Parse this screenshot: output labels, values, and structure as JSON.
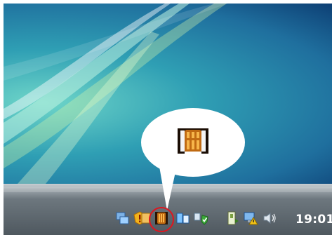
{
  "taskbar": {
    "clock_time": "19:01"
  },
  "tray_icons": [
    "network-connections-icon",
    "security-alert-icon",
    "firewall-icon",
    "pcmcia-device-icon",
    "defender-shield-icon",
    "pc-card-icon",
    "display-warning-icon",
    "volume-icon"
  ],
  "colors": {
    "highlight_ring": "#e0141e",
    "callout_fill": "#ffffff",
    "taskbar_dark": "#4f585f",
    "desktop_teal": "#2f9fb4"
  }
}
